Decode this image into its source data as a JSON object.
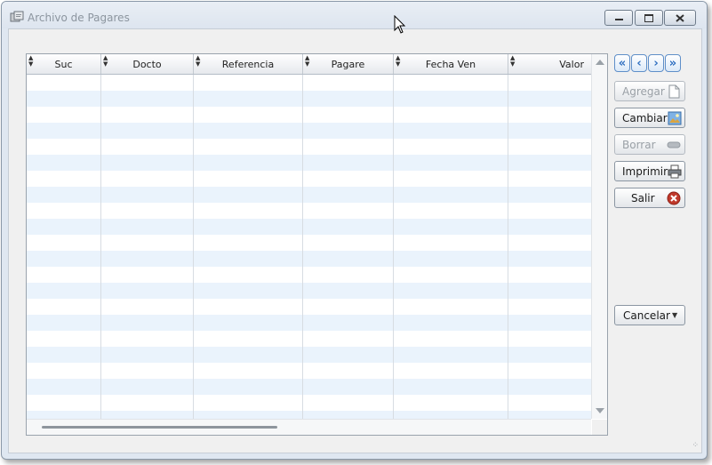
{
  "window": {
    "title": "Archivo de Pagares"
  },
  "grid": {
    "columns": [
      {
        "label": "Suc",
        "align": "center"
      },
      {
        "label": "Docto",
        "align": "center"
      },
      {
        "label": "Referencia",
        "align": "center"
      },
      {
        "label": "Pagare",
        "align": "center"
      },
      {
        "label": "Fecha Ven",
        "align": "center"
      },
      {
        "label": "Valor",
        "align": "right"
      }
    ],
    "rows": []
  },
  "nav": {
    "first_icon": "double-chevron-left-icon",
    "prev_icon": "chevron-left-icon",
    "next_icon": "chevron-right-icon",
    "last_icon": "double-chevron-right-icon"
  },
  "actions": {
    "agregar": {
      "label": "Agregar",
      "icon": "document-icon",
      "enabled": false
    },
    "cambiar": {
      "label": "Cambiar",
      "icon": "picture-icon",
      "enabled": true
    },
    "borrar": {
      "label": "Borrar",
      "icon": "minus-icon",
      "enabled": false
    },
    "imprimir": {
      "label": "Imprimir",
      "icon": "printer-icon",
      "enabled": true
    },
    "salir": {
      "label": "Salir",
      "icon": "close-circle-icon",
      "enabled": true
    }
  },
  "cancel": {
    "label": "Cancelar"
  },
  "colors": {
    "accent": "#2f6fc1",
    "row_alt": "#eaf3fc",
    "close_red": "#c0392b"
  }
}
